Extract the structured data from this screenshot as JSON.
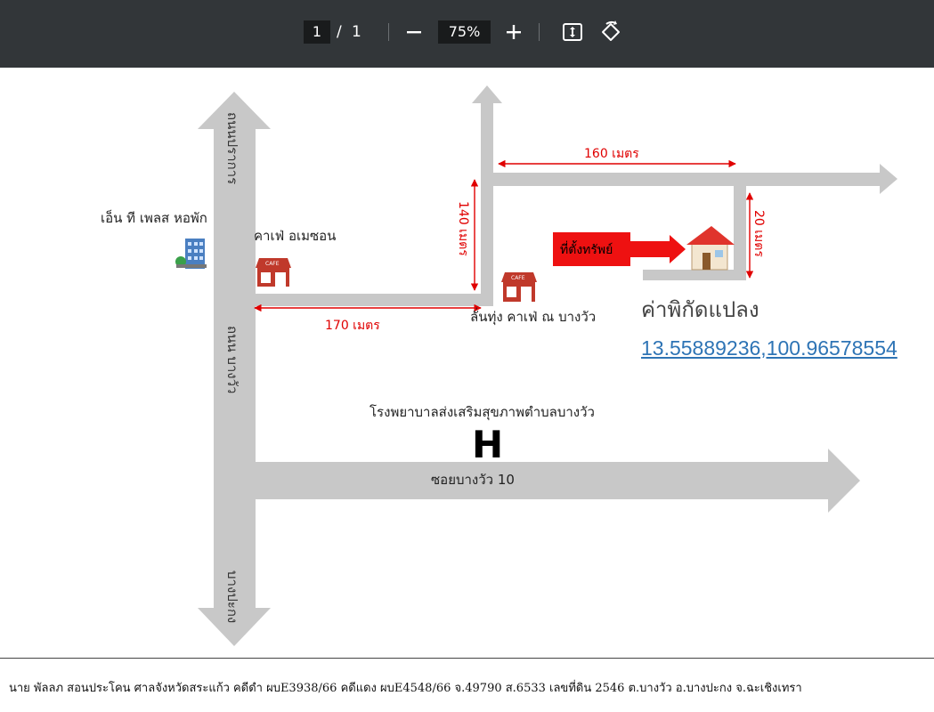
{
  "toolbar": {
    "page_current": "1",
    "page_separator": "/",
    "page_total": "1",
    "zoom": "75%",
    "icons": [
      "minus-icon",
      "plus-icon",
      "fit-page-icon",
      "rotate-icon"
    ]
  },
  "map": {
    "road_left_top": "ถนนปราการ",
    "road_left_middle": "ถนน บางวัว",
    "road_left_bottom": "บางปะกง",
    "hostel_label": "เอ็น ที เพลส หอพัก",
    "cafe_amazon_label": "คาเฟ่ อเมซอน",
    "cafe_lantung_label": "ลั่นทุ่ง คาเฟ่ ณ บางวัว",
    "distance_170": "170 เมตร",
    "distance_140": "140 เมตร",
    "distance_160": "160 เมตร",
    "distance_20": "20 เมตร",
    "property_label": "ที่ตั้งทรัพย์",
    "coord_heading": "ค่าพิกัดแปลง",
    "coordinates": "13.55889236,100.96578554",
    "hospital_label": "โรงพยาบาลส่งเสริมสุขภาพตำบลบางวัว",
    "hospital_letter": "H",
    "soi_label": "ซอยบางวัว 10",
    "cafe_sign": "CAFE",
    "colors": {
      "road": "#c8c8c8",
      "distance": "#e00000",
      "link": "#2e74b5"
    }
  },
  "footer": {
    "text": "นาย พัลลภ สอนประโคน ศาลจังหวัดสระแก้ว คดีดำ ผบE3938/66 คดีแดง ผบE4548/66   จ.49790  ส.6533 เลขที่ดิน 2546 ต.บางวัว อ.บางปะกง  จ.ฉะเชิงเทรา"
  }
}
